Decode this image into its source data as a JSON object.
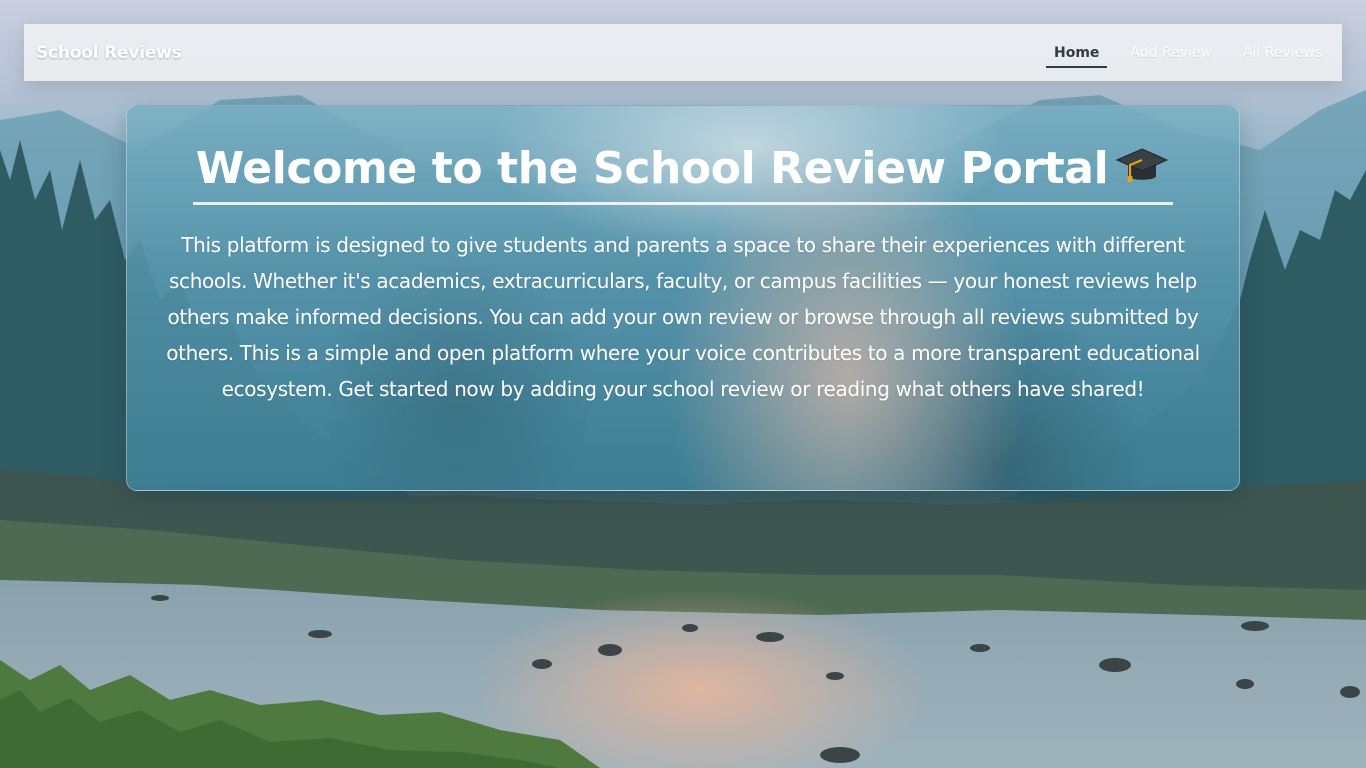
{
  "navbar": {
    "brand": "School Reviews",
    "links": [
      {
        "label": "Home",
        "active": true
      },
      {
        "label": "Add Review",
        "active": false
      },
      {
        "label": "All Reviews",
        "active": false
      }
    ]
  },
  "hero": {
    "title": "Welcome to the School Review Portal",
    "title_icon": "graduation-cap-icon",
    "description": "This platform is designed to give students and parents a space to share their experiences with different schools. Whether it's academics, extracurriculars, faculty, or campus facilities — your honest reviews help others make informed decisions. You can add your own review or browse through all reviews submitted by others. This is a simple and open platform where your voice contributes to a more transparent educational ecosystem. Get started now by adding your school review or reading what others have shared!"
  },
  "colors": {
    "navbar_bg": "#eceff1",
    "active_link": "#333a40",
    "hero_bg": "#5291a8",
    "text": "#ffffff"
  }
}
